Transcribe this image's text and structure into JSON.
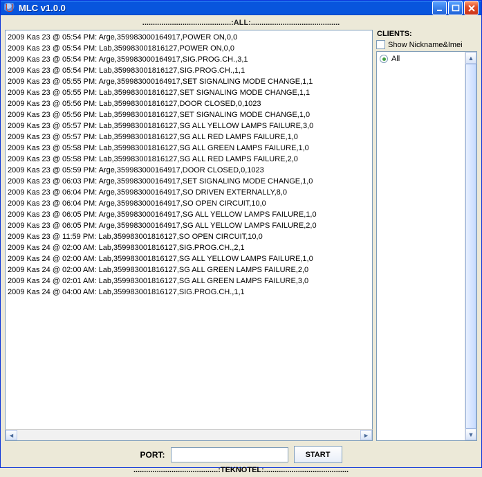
{
  "window": {
    "title": "MLC v1.0.0"
  },
  "header": {
    "all_label": "..........................................:ALL:.........................................."
  },
  "log": {
    "lines": [
      "2009 Kas 23 @ 05:54 PM: Arge,359983000164917,POWER ON,0,0",
      "2009 Kas 23 @ 05:54 PM: Lab,359983001816127,POWER ON,0,0",
      "2009 Kas 23 @ 05:54 PM: Arge,359983000164917,SIG.PROG.CH.,3,1",
      "2009 Kas 23 @ 05:54 PM: Lab,359983001816127,SIG.PROG.CH.,1,1",
      "2009 Kas 23 @ 05:55 PM: Arge,359983000164917,SET SIGNALING MODE CHANGE,1,1",
      "2009 Kas 23 @ 05:55 PM: Lab,359983001816127,SET SIGNALING MODE CHANGE,1,1",
      "2009 Kas 23 @ 05:56 PM: Lab,359983001816127,DOOR CLOSED,0,1023",
      "2009 Kas 23 @ 05:56 PM: Lab,359983001816127,SET SIGNALING MODE CHANGE,1,0",
      "2009 Kas 23 @ 05:57 PM: Lab,359983001816127,SG ALL YELLOW LAMPS FAILURE,3,0",
      "2009 Kas 23 @ 05:57 PM: Lab,359983001816127,SG ALL RED LAMPS FAILURE,1,0",
      "2009 Kas 23 @ 05:58 PM: Lab,359983001816127,SG ALL GREEN LAMPS FAILURE,1,0",
      "2009 Kas 23 @ 05:58 PM: Lab,359983001816127,SG ALL RED LAMPS FAILURE,2,0",
      "2009 Kas 23 @ 05:59 PM: Arge,359983000164917,DOOR CLOSED,0,1023",
      "2009 Kas 23 @ 06:03 PM: Arge,359983000164917,SET SIGNALING MODE CHANGE,1,0",
      "2009 Kas 23 @ 06:04 PM: Arge,359983000164917,SO DRIVEN EXTERNALLY,8,0",
      "2009 Kas 23 @ 06:04 PM: Arge,359983000164917,SO OPEN CIRCUIT,10,0",
      "2009 Kas 23 @ 06:05 PM: Arge,359983000164917,SG ALL YELLOW LAMPS FAILURE,1,0",
      "2009 Kas 23 @ 06:05 PM: Arge,359983000164917,SG ALL YELLOW LAMPS FAILURE,2,0",
      "2009 Kas 23 @ 11:59 PM: Lab,359983001816127,SO OPEN CIRCUIT,10,0",
      "2009 Kas 24 @ 02:00 AM: Lab,359983001816127,SIG.PROG.CH.,2,1",
      "2009 Kas 24 @ 02:00 AM: Lab,359983001816127,SG ALL YELLOW LAMPS FAILURE,1,0",
      "2009 Kas 24 @ 02:00 AM: Lab,359983001816127,SG ALL GREEN LAMPS FAILURE,2,0",
      "2009 Kas 24 @ 02:01 AM: Lab,359983001816127,SG ALL GREEN LAMPS FAILURE,3,0",
      "2009 Kas 24 @ 04:00 AM: Lab,359983001816127,SIG.PROG.CH.,1,1"
    ]
  },
  "side": {
    "clients_label": "CLIENTS:",
    "show_checkbox_label": "Show Nickname&Imei",
    "radio_all_label": "All"
  },
  "port": {
    "label": "PORT:",
    "value": "",
    "start_label": "START"
  },
  "footer": {
    "label": "........................................:TEKNOTEL:........................................"
  }
}
